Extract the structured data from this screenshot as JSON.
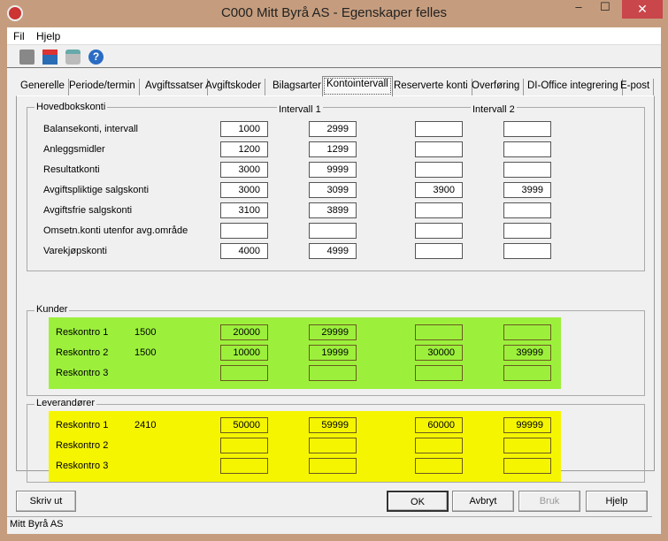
{
  "window": {
    "title": "C000 Mitt Byrå AS - Egenskaper felles",
    "minimize": "–",
    "maximize": "☐",
    "close": "✕"
  },
  "menu": [
    "Fil",
    "Hjelp"
  ],
  "toolbar": [
    "save-icon",
    "delete-icon",
    "print-icon",
    "help-icon"
  ],
  "tabs": [
    "Generelle",
    "Periode/termin",
    "Avgiftssatser",
    "Avgiftskoder",
    "Bilagsarter",
    "Kontointervall",
    "Reserverte konti",
    "Overføring",
    "DI-Office integrering",
    "E-post"
  ],
  "active_tab": "Kontointervall",
  "hovedbok": {
    "label": "Hovedbokskonti",
    "interval1": "Intervall 1",
    "interval2": "Intervall 2",
    "rows": [
      {
        "label": "Balansekonti, intervall",
        "v": [
          "1000",
          "2999",
          "",
          ""
        ]
      },
      {
        "label": "Anleggsmidler",
        "v": [
          "1200",
          "1299",
          "",
          ""
        ]
      },
      {
        "label": "Resultatkonti",
        "v": [
          "3000",
          "9999",
          "",
          ""
        ]
      },
      {
        "label": "Avgiftspliktige salgskonti",
        "v": [
          "3000",
          "3099",
          "3900",
          "3999"
        ]
      },
      {
        "label": "Avgiftsfrie salgskonti",
        "v": [
          "3100",
          "3899",
          "",
          ""
        ]
      },
      {
        "label": "Omsetn.konti utenfor avg.område",
        "v": [
          "",
          "",
          "",
          ""
        ]
      },
      {
        "label": "Varekjøpskonti",
        "v": [
          "4000",
          "4999",
          "",
          ""
        ]
      }
    ]
  },
  "kunder": {
    "label": "Kunder",
    "color": "#9cf03c",
    "rows": [
      {
        "label": "Reskontro 1",
        "account": "1500",
        "v": [
          "20000",
          "29999",
          "",
          ""
        ]
      },
      {
        "label": "Reskontro 2",
        "account": "1500",
        "v": [
          "10000",
          "19999",
          "30000",
          "39999"
        ]
      },
      {
        "label": "Reskontro 3",
        "account": "",
        "v": [
          "",
          "",
          "",
          ""
        ]
      }
    ]
  },
  "leverandorer": {
    "label": "Leverandører",
    "color": "#f5f500",
    "rows": [
      {
        "label": "Reskontro 1",
        "account": "2410",
        "v": [
          "50000",
          "59999",
          "60000",
          "99999"
        ]
      },
      {
        "label": "Reskontro 2",
        "account": "",
        "v": [
          "",
          "",
          "",
          ""
        ]
      },
      {
        "label": "Reskontro 3",
        "account": "",
        "v": [
          "",
          "",
          "",
          ""
        ]
      }
    ]
  },
  "buttons": {
    "print": "Skriv ut",
    "ok": "OK",
    "cancel": "Avbryt",
    "apply": "Bruk",
    "help": "Hjelp"
  },
  "status": "Mitt Byrå AS"
}
